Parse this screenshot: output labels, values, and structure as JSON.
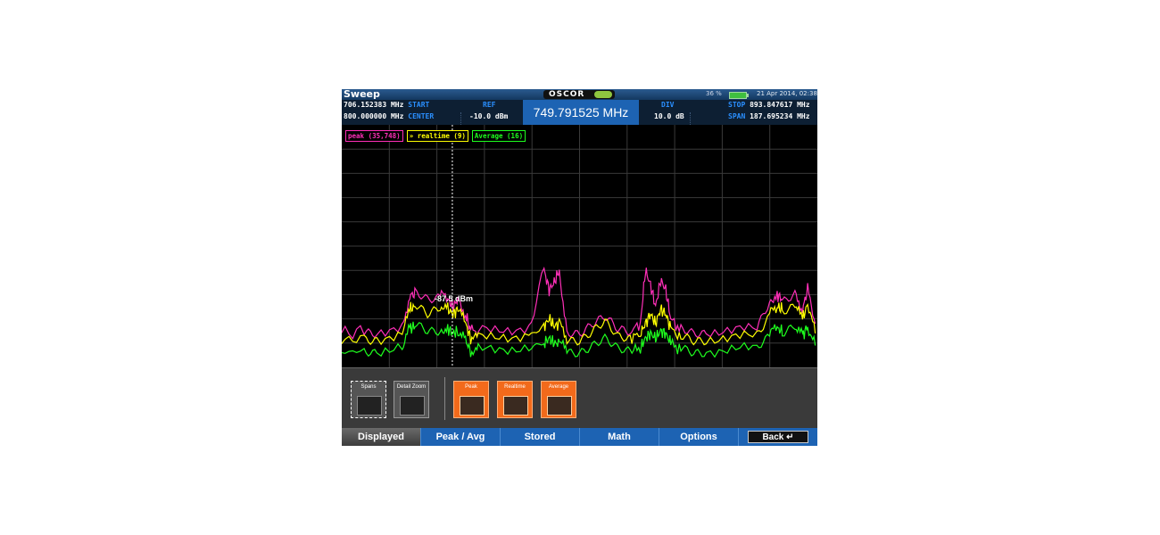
{
  "titlebar": {
    "app_title": "Sweep",
    "logo": "OSCOR",
    "battery_percent": "36 %",
    "datetime": "21 Apr 2014, 02:38"
  },
  "header": {
    "start_value": "706.152383 MHz",
    "start_label": "START",
    "center_value": "800.000000 MHz",
    "center_label": "CENTER",
    "ref_label": "REF",
    "ref_value": "-10.0 dBm",
    "marker_freq": "749.791525 MHz",
    "div_label": "DIV",
    "div_value": "10.0 dB",
    "stop_label": "STOP",
    "stop_value": "893.847617 MHz",
    "span_label": "SPAN",
    "span_value": "187.695234 MHz"
  },
  "legend": {
    "peak": "peak (35,748)",
    "realtime": "» realtime (9)",
    "average": "Average (16)"
  },
  "marker_label": "-87.5 dBm",
  "controls": {
    "spans": "Spans",
    "detail_zoom": "Detail Zoom",
    "peak": "Peak",
    "realtime": "Realtime",
    "average": "Average"
  },
  "tabs": {
    "displayed": "Displayed",
    "peak_avg": "Peak / Avg",
    "stored": "Stored",
    "math": "Math",
    "options": "Options",
    "back": "Back"
  },
  "colors": {
    "peak": "#ff2fb8",
    "realtime": "#ffff00",
    "average": "#1eff1e",
    "accent": "#1d63b3"
  },
  "chart_data": {
    "type": "line",
    "x_unit": "MHz",
    "y_unit": "dBm",
    "xlim": [
      706.152383,
      893.847617
    ],
    "ylim": [
      -110,
      -10
    ],
    "marker_x": 749.791525,
    "series": [
      {
        "name": "peak",
        "x": [
          706,
          715,
          720,
          730,
          733,
          735,
          740,
          745,
          748,
          750,
          752,
          755,
          757,
          760,
          770,
          780,
          786,
          788,
          790,
          792,
          795,
          800,
          805,
          810,
          815,
          820,
          824,
          826,
          828,
          830,
          832,
          834,
          836,
          840,
          845,
          850,
          860,
          870,
          875,
          878,
          880,
          885,
          888,
          890,
          893
        ],
        "y": [
          -96,
          -95,
          -95,
          -94,
          -80,
          -80,
          -82,
          -80,
          -82,
          -85,
          -82,
          -88,
          -95,
          -95,
          -94,
          -94,
          -70,
          -78,
          -75,
          -70,
          -95,
          -95,
          -92,
          -90,
          -95,
          -95,
          -92,
          -70,
          -76,
          -85,
          -74,
          -78,
          -90,
          -95,
          -96,
          -95,
          -95,
          -94,
          -82,
          -80,
          -82,
          -80,
          -86,
          -78,
          -92
        ]
      },
      {
        "name": "realtime",
        "x": [
          706,
          715,
          720,
          730,
          733,
          735,
          740,
          745,
          748,
          750,
          752,
          755,
          757,
          760,
          770,
          780,
          786,
          788,
          790,
          792,
          795,
          800,
          805,
          810,
          815,
          820,
          824,
          826,
          828,
          830,
          832,
          834,
          836,
          840,
          845,
          850,
          860,
          870,
          875,
          878,
          880,
          885,
          888,
          890,
          893
        ],
        "y": [
          -99,
          -98,
          -98,
          -97,
          -86,
          -85,
          -88,
          -84,
          -86,
          -88,
          -86,
          -92,
          -98,
          -98,
          -97,
          -97,
          -93,
          -90,
          -93,
          -92,
          -98,
          -98,
          -95,
          -92,
          -98,
          -98,
          -96,
          -92,
          -88,
          -92,
          -86,
          -88,
          -94,
          -98,
          -99,
          -98,
          -98,
          -97,
          -88,
          -85,
          -86,
          -85,
          -90,
          -84,
          -96
        ]
      },
      {
        "name": "average",
        "x": [
          706,
          715,
          720,
          730,
          733,
          735,
          740,
          745,
          748,
          750,
          752,
          755,
          757,
          760,
          770,
          780,
          786,
          788,
          790,
          792,
          795,
          800,
          805,
          810,
          815,
          820,
          824,
          826,
          828,
          830,
          832,
          834,
          836,
          840,
          845,
          850,
          860,
          870,
          875,
          878,
          880,
          885,
          888,
          890,
          893
        ],
        "y": [
          -104,
          -103,
          -103,
          -102,
          -94,
          -93,
          -95,
          -94,
          -94,
          -96,
          -95,
          -99,
          -103,
          -103,
          -102,
          -102,
          -100,
          -98,
          -100,
          -100,
          -103,
          -103,
          -101,
          -99,
          -103,
          -103,
          -102,
          -98,
          -96,
          -98,
          -95,
          -96,
          -100,
          -103,
          -104,
          -103,
          -103,
          -102,
          -96,
          -94,
          -95,
          -93,
          -97,
          -93,
          -101
        ]
      }
    ],
    "grid": true
  }
}
